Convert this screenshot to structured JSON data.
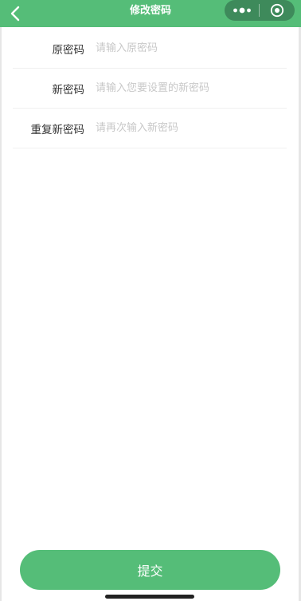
{
  "nav": {
    "title": "修改密码",
    "back_icon": "chevron-left-icon",
    "more_icon": "more-dots-icon",
    "close_icon": "target-circle-icon",
    "color": "#55bd78"
  },
  "form": {
    "fields": [
      {
        "label": "原密码",
        "placeholder": "请输入原密码",
        "value": ""
      },
      {
        "label": "新密码",
        "placeholder": "请输入您要设置的新密码",
        "value": ""
      },
      {
        "label": "重复新密码",
        "placeholder": "请再次输入新密码",
        "value": ""
      }
    ]
  },
  "submit": {
    "label": "提交",
    "color": "#55bd78"
  }
}
